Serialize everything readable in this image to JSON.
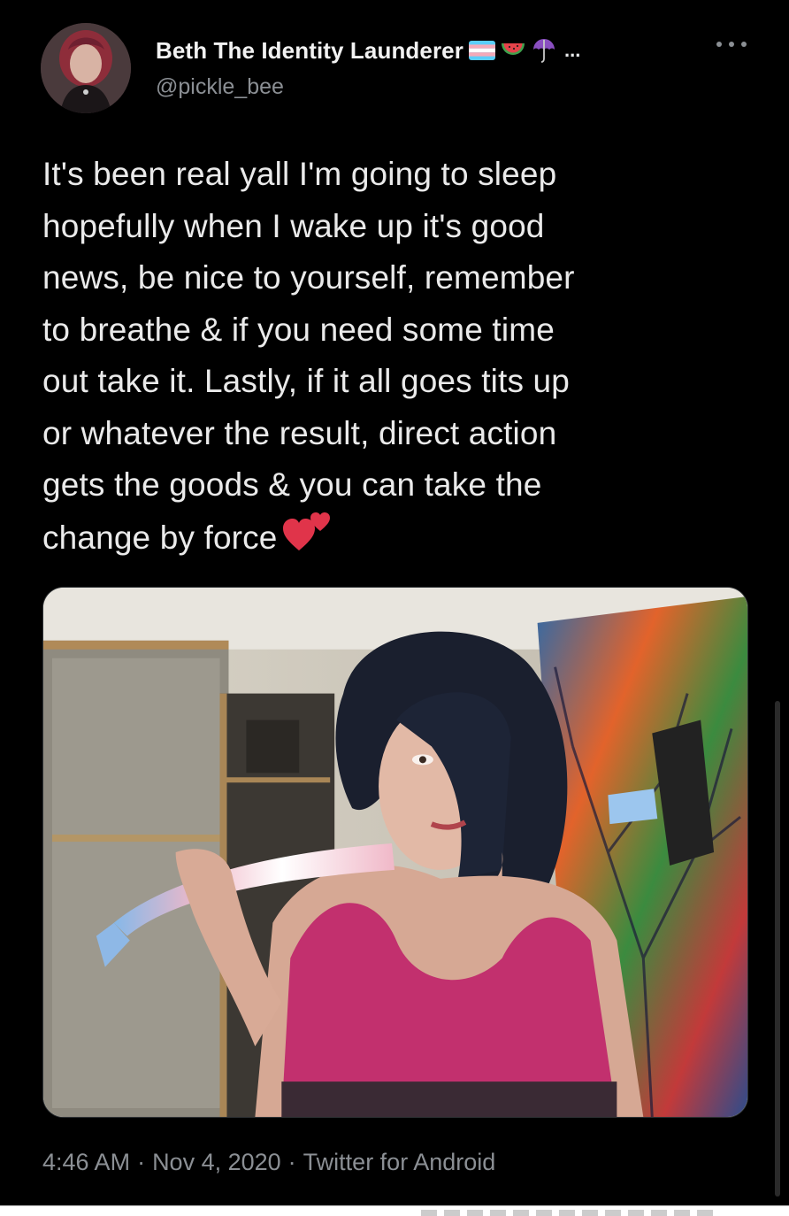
{
  "author": {
    "display_name": "Beth The Identity Launderer",
    "name_suffix": "...",
    "handle": "@pickle_bee",
    "name_emojis": [
      "transgender-flag-icon",
      "watermelon-icon",
      "umbrella-icon"
    ]
  },
  "tweet": {
    "lines": [
      "It's been real yall I'm going to sleep",
      "hopefully when I wake up it's good",
      "news, be nice to yourself, remember",
      "to breathe & if you need some time",
      "out take it. Lastly, if it all goes tits up",
      "or whatever the result, direct action",
      "gets the goods & you can take the",
      "change by force"
    ],
    "trailing_emoji": "two-hearts-icon"
  },
  "meta": {
    "time": "4:46 AM",
    "separator": "·",
    "date": "Nov 4, 2020",
    "source": "Twitter for Android"
  },
  "colors": {
    "background": "#000000",
    "text": "#e7e9ea",
    "secondary": "#8b8f94",
    "heart": "#e0344a"
  }
}
